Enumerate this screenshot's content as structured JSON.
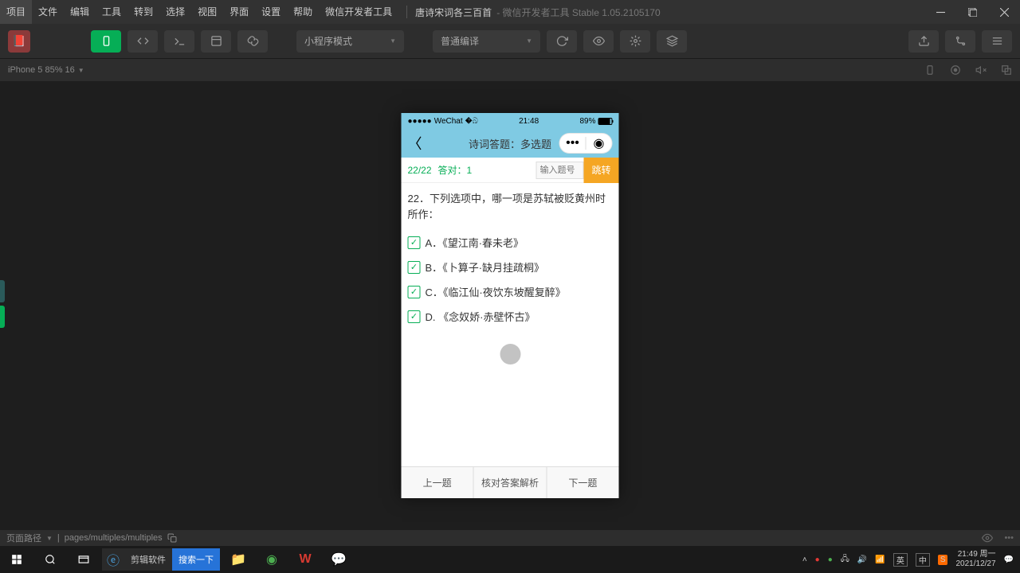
{
  "menu": [
    "项目",
    "文件",
    "编辑",
    "工具",
    "转到",
    "选择",
    "视图",
    "界面",
    "设置",
    "帮助",
    "微信开发者工具"
  ],
  "app": {
    "title": "唐诗宋词各三百首",
    "subtitle": "- 微信开发者工具 Stable 1.05.2105170"
  },
  "toolbar": {
    "mode": "小程序模式",
    "compile": "普通编译"
  },
  "device": {
    "info": "iPhone 5 85% 16"
  },
  "phone": {
    "status": {
      "carrier": "WeChat",
      "time": "21:48",
      "battery": "89%"
    },
    "nav_title": "诗词答题：多选题",
    "progress": "22/22",
    "correct_label": "答对：",
    "correct_count": "1",
    "input_placeholder": "输入题号",
    "jump": "跳转",
    "question": "22．下列选项中，哪一项是苏轼被贬黄州时所作：",
    "choices": [
      {
        "label": "A",
        "text": "《望江南·春未老》"
      },
      {
        "label": "B",
        "text": "《卜算子·缺月挂疏桐》"
      },
      {
        "label": "C",
        "text": "《临江仙·夜饮东坡醒复醉》"
      },
      {
        "label": "D",
        "text": "《念奴娇·赤壁怀古》"
      }
    ],
    "bottom": [
      "上一题",
      "核对答案解析",
      "下一题"
    ]
  },
  "footer": {
    "path_label": "页面路径",
    "path": "pages/multiples/multiples"
  },
  "taskbar": {
    "search_label": "剪辑软件",
    "search_go": "搜索一下",
    "time": "21:49 周一",
    "date": "2021/12/27",
    "ime1": "英",
    "ime2": "中"
  }
}
